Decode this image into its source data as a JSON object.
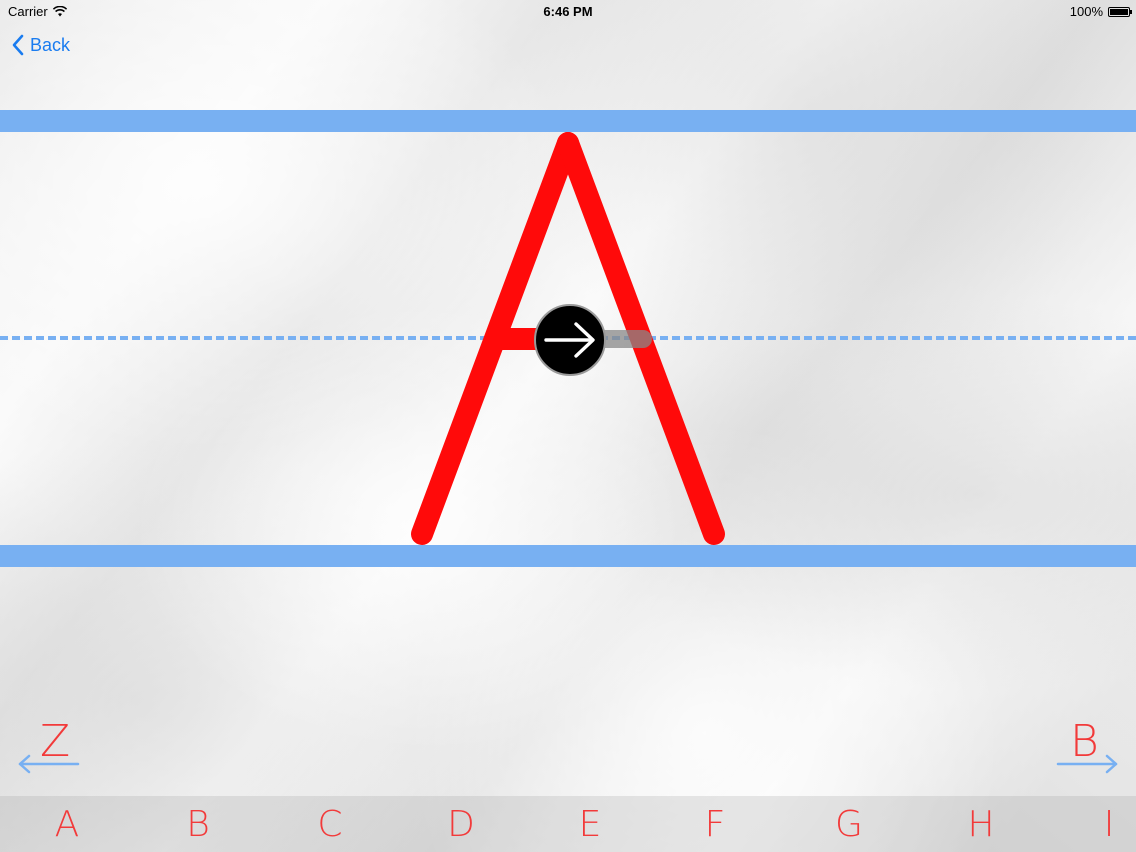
{
  "status_bar": {
    "carrier": "Carrier",
    "time": "6:46 PM",
    "battery": "100%"
  },
  "nav": {
    "back_label": "Back"
  },
  "tracing": {
    "letter": "A",
    "stroke_color": "#ff0a0a",
    "guide_color": "#78b0f2",
    "direction_icon": "arrow-right-icon"
  },
  "letter_nav": {
    "previous_letter": "Z",
    "next_letter": "B"
  },
  "alphabet": [
    "A",
    "B",
    "C",
    "D",
    "E",
    "F",
    "G",
    "H",
    "I"
  ],
  "colors": {
    "accent": "#1a7cf0",
    "letter_red": "#f23a3a"
  }
}
